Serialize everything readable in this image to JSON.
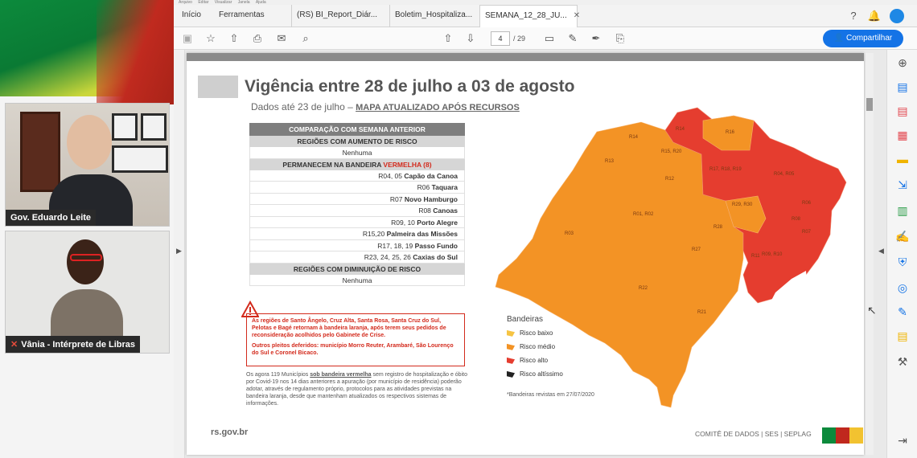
{
  "video": {
    "presenter_name": "Gov. Eduardo Leite",
    "interpreter_name": "Vânia - Intérprete de Libras"
  },
  "menu": [
    "Arquivo",
    "Editar",
    "Visualizar",
    "Janela",
    "Ajuda"
  ],
  "tabs": {
    "home": "Início",
    "tools": "Ferramentas",
    "doc1": "(RS) BI_Report_Diár...",
    "doc2": "Boletim_Hospitaliza...",
    "doc3": "SEMANA_12_28_JU..."
  },
  "toolbar": {
    "current_page": "4",
    "total_pages": "/ 29",
    "share_label": "Compartilhar"
  },
  "slide": {
    "title": "Vigência entre 28 de julho a 03 de agosto",
    "subtitle_prefix": "Dados até 23 de julho – ",
    "subtitle_link": "MAPA ATUALIZADO APÓS RECURSOS",
    "table": {
      "header": "COMPARAÇÃO COM SEMANA ANTERIOR",
      "increase_header": "REGIÕES COM AUMENTO DE RISCO",
      "increase_value": "Nenhuma",
      "stay_header_prefix": "PERMANECEM NA BANDEIRA ",
      "stay_header_flag": "VERMELHA (8)",
      "rows": [
        {
          "codes": "R04, 05",
          "city": "Capão da Canoa"
        },
        {
          "codes": "R06",
          "city": "Taquara"
        },
        {
          "codes": "R07",
          "city": "Novo Hamburgo"
        },
        {
          "codes": "R08",
          "city": "Canoas"
        },
        {
          "codes": "R09, 10",
          "city": "Porto Alegre"
        },
        {
          "codes": "R15,20",
          "city": "Palmeira das Missões"
        },
        {
          "codes": "R17, 18, 19",
          "city": "Passo Fundo"
        },
        {
          "codes": "R23, 24, 25, 26",
          "city": "Caxias do Sul"
        }
      ],
      "decrease_header": "REGIÕES COM DIMINUIÇÃO DE RISCO",
      "decrease_value": "Nenhuma"
    },
    "warning_1": "As regiões de Santo Ângelo, Cruz Alta, Santa Rosa, Santa Cruz do Sul, Pelotas e Bagé retornam à bandeira laranja, após terem seus pedidos de reconsideração acolhidos pelo Gabinete de Crise.",
    "warning_2": "Outros pleitos deferidos: município Morro Reuter, Arambaré, São Lourenço do Sul e Coronel Bicaco.",
    "note_prefix": "Os agora 119 Municípios ",
    "note_link": "sob bandeira vermelha",
    "note_suffix": " sem registro de hospitalização e óbito por Covid-19 nos 14 dias anteriores a apuração (por município de residência) poderão adotar, através de regulamento próprio, protocolos para as atividades previstas na bandeira laranja, desde que mantenham atualizados os respectivos sistemas de informações.",
    "url": "rs.gov.br",
    "credits": "COMITÊ DE DADOS  |  SES  |  SEPLAG"
  },
  "legend": {
    "title": "Bandeiras",
    "items": [
      {
        "label": "Risco baixo",
        "color": "#f6c443"
      },
      {
        "label": "Risco médio",
        "color": "#f39325"
      },
      {
        "label": "Risco alto",
        "color": "#e53d2f"
      },
      {
        "label": "Risco altíssimo",
        "color": "#222222"
      }
    ],
    "note": "*Bandeiras revistas em 27/07/2020"
  },
  "map_labels": [
    "R01",
    "R02",
    "R03",
    "R04, R05",
    "R06",
    "R07",
    "R08",
    "R09, R10",
    "R11",
    "R12",
    "R13",
    "R14",
    "R15, R20",
    "R16",
    "R17, R18, R19",
    "R21",
    "R22",
    "R23, R24, R25, R26",
    "R27",
    "R28",
    "R29, R30",
    "R01, R02"
  ],
  "colors": {
    "orange": "#f39325",
    "red": "#e53d2f",
    "accent_blue": "#1473e6",
    "brand_green": "#0c8a3c"
  }
}
